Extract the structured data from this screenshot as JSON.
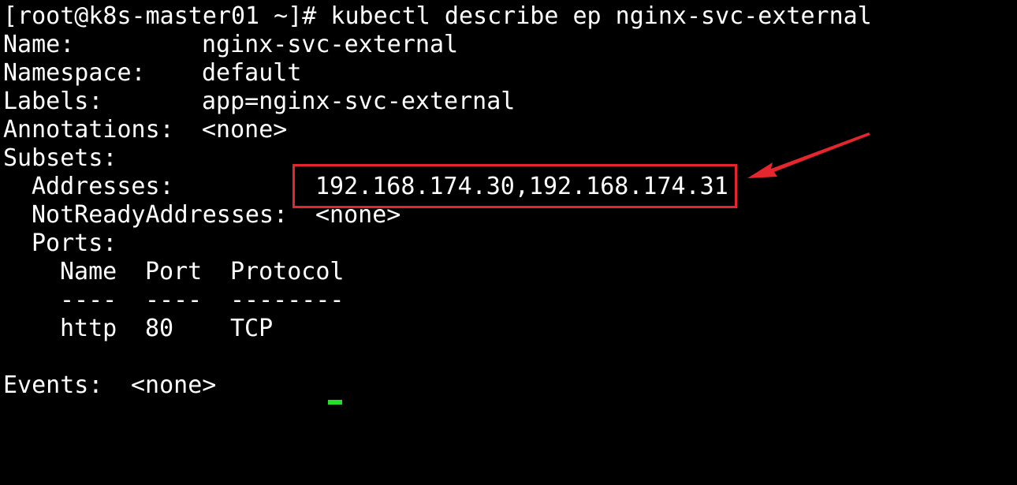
{
  "colors": {
    "background": "#000000",
    "text": "#ffffff",
    "annotation": "#e6262e",
    "cursor": "#22e02a"
  },
  "terminal": {
    "prompt": "[root@k8s-master01 ~]# ",
    "command": "kubectl describe ep nginx-svc-external",
    "fields": {
      "name_label": "Name:",
      "name_value": "nginx-svc-external",
      "namespace_label": "Namespace:",
      "namespace_value": "default",
      "labels_label": "Labels:",
      "labels_value": "app=nginx-svc-external",
      "annotations_label": "Annotations:",
      "annotations_value": "<none>",
      "subsets_label": "Subsets:",
      "addresses_label": "Addresses:",
      "addresses_value": "192.168.174.30,192.168.174.31",
      "not_ready_label": "NotReadyAddresses:",
      "not_ready_value": "<none>",
      "ports_label": "Ports:",
      "events_label": "Events:",
      "events_value": "<none>"
    },
    "ports_table": {
      "headers": [
        "Name",
        "Port",
        "Protocol"
      ],
      "separators": [
        "----",
        "----",
        "--------"
      ],
      "rows": [
        [
          "http",
          "80",
          "TCP"
        ]
      ]
    }
  },
  "annotation": {
    "icon": "arrow-icon"
  }
}
